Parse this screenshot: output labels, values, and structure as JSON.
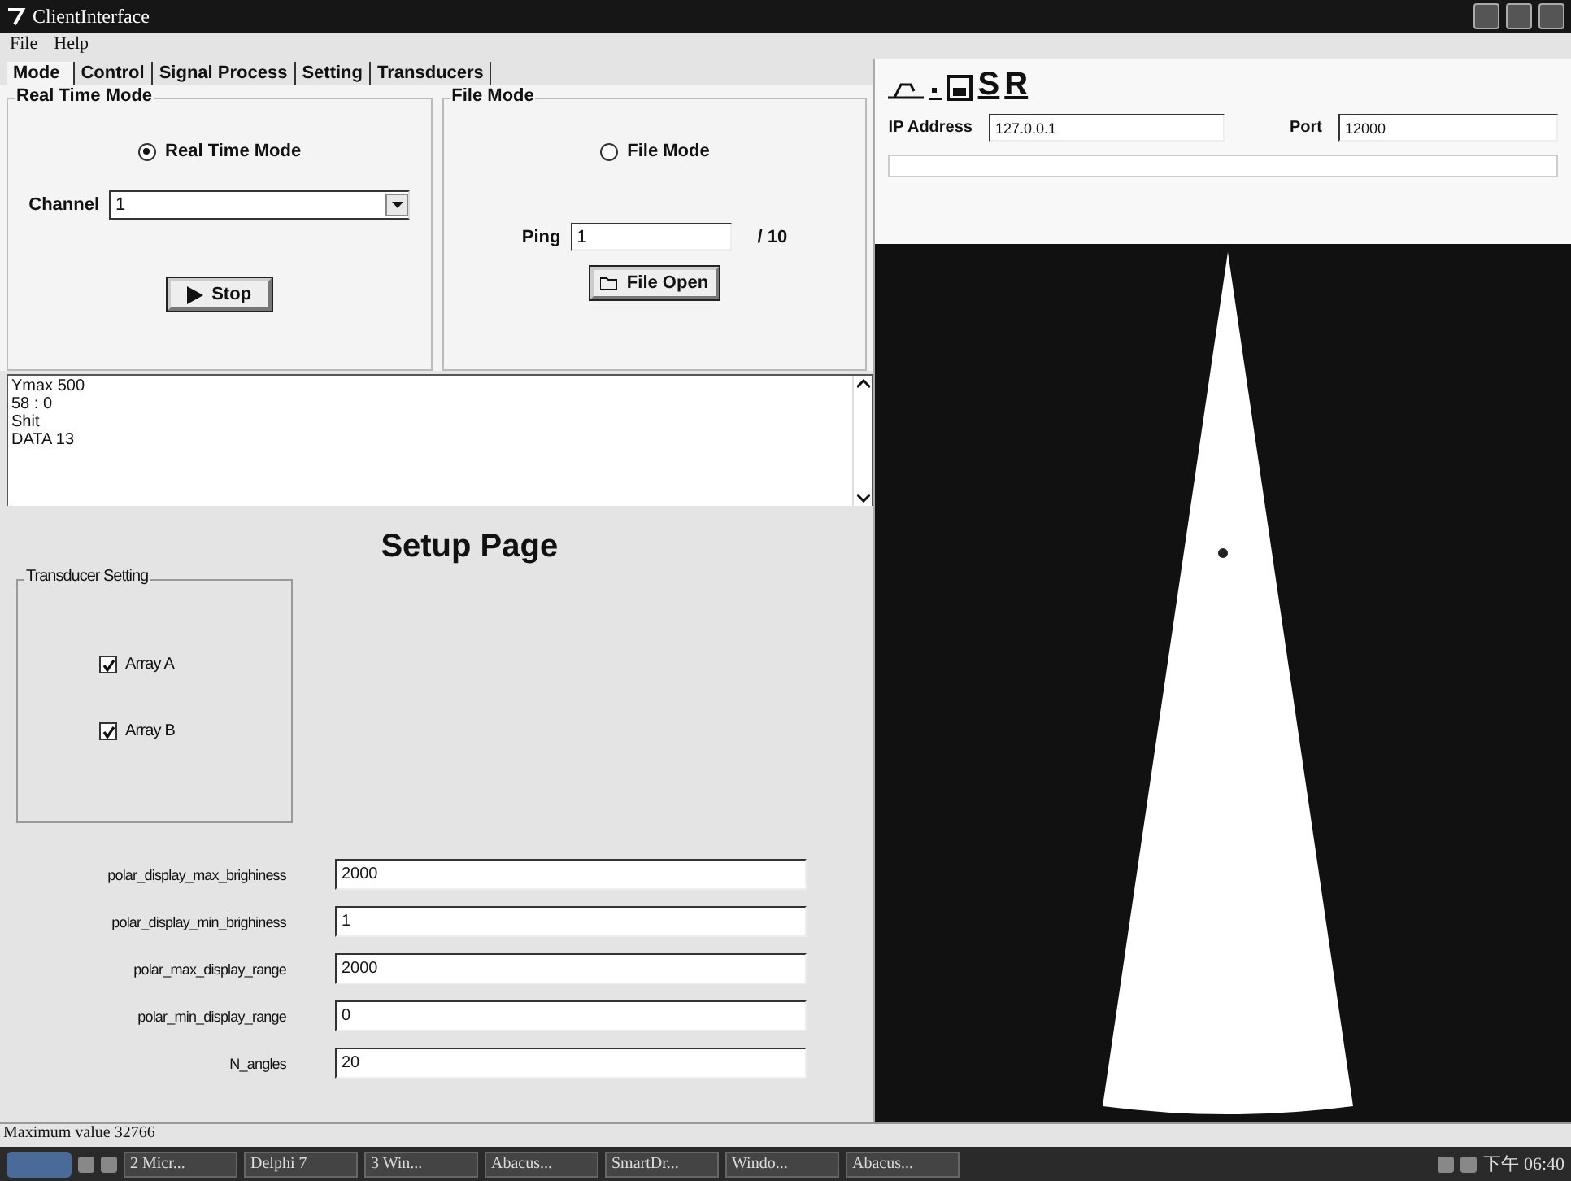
{
  "window": {
    "title": "ClientInterface"
  },
  "menu": [
    "File",
    "Help"
  ],
  "tabs": [
    {
      "label": "Mode",
      "selected": true
    },
    {
      "label": "Control",
      "selected": false
    },
    {
      "label": "Signal Process",
      "selected": false
    },
    {
      "label": "Setting",
      "selected": false
    },
    {
      "label": "Transducers",
      "selected": false
    }
  ],
  "real_time_group": {
    "title": "Real Time Mode",
    "radio": {
      "label": "Real Time Mode",
      "selected": true
    },
    "channel_label": "Channel",
    "channel_value": "1",
    "stop_button": "Stop"
  },
  "file_group": {
    "title": "File Mode",
    "radio": {
      "label": "File Mode",
      "selected": false
    },
    "ping_label": "Ping",
    "ping_value": "1",
    "ping_total": "/ 10",
    "open_button": "File Open"
  },
  "log_lines": [
    "Ymax 500",
    "58 : 0",
    "Shit",
    "DATA 13"
  ],
  "setup": {
    "title": "Setup Page",
    "group_title": "Transducer Setting",
    "arrays": [
      {
        "label": "Array A",
        "checked": true
      },
      {
        "label": "Array B",
        "checked": true
      }
    ],
    "params": [
      {
        "label": "polar_display_max_brighiness",
        "value": "2000"
      },
      {
        "label": "polar_display_min_brighiness",
        "value": "1"
      },
      {
        "label": "polar_max_display_range",
        "value": "2000"
      },
      {
        "label": "polar_min_display_range",
        "value": "0"
      },
      {
        "label": "N_angles",
        "value": "20"
      }
    ]
  },
  "toolbar": {
    "letters": [
      "S",
      "R"
    ]
  },
  "connection": {
    "ip_label": "IP Address",
    "ip_value": "127.0.0.1",
    "port_label": "Port",
    "port_value": "12000"
  },
  "status_bar": "Maximum value  32766",
  "taskbar": {
    "items": [
      "2 Micr...",
      "Delphi 7",
      "3 Win...",
      "Abacus...",
      "SmartDr...",
      "Windo...",
      "Abacus..."
    ],
    "clock": "下午 06:40"
  }
}
